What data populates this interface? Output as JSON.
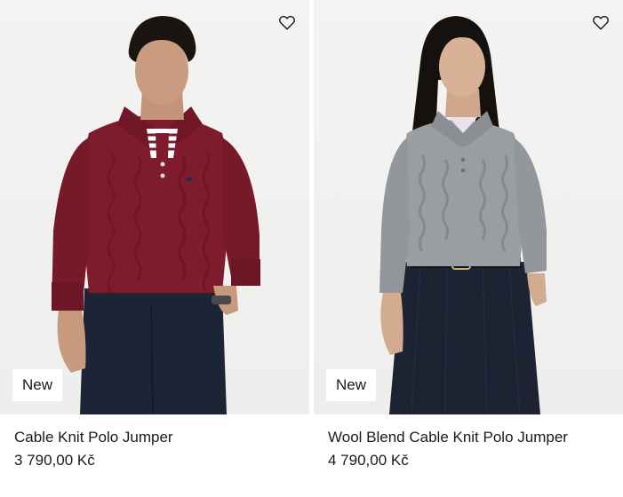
{
  "products": [
    {
      "name": "Cable Knit Polo Jumper",
      "price": "3 790,00 Kč",
      "badge": "New",
      "wishlist_icon": "heart-outline-icon",
      "colors": {
        "jumper": "#7e1b2c",
        "trousers": "#1c2536",
        "background": "#f1f1f0"
      }
    },
    {
      "name": "Wool Blend Cable Knit Polo Jumper",
      "price": "4 790,00 Kč",
      "badge": "New",
      "wishlist_icon": "heart-outline-icon",
      "colors": {
        "jumper": "#9a9da1",
        "trousers": "#1d2333",
        "background": "#f1f1f0"
      }
    }
  ]
}
